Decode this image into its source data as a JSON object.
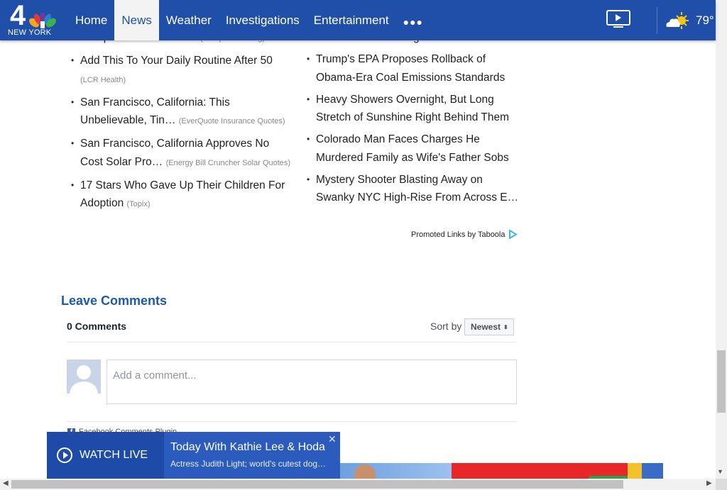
{
  "header": {
    "logo_number": "4",
    "logo_city": "NEW YORK",
    "nav": [
      "Home",
      "News",
      "Weather",
      "Investigations",
      "Entertainment"
    ],
    "active_nav": "News",
    "more_icon": "ellipsis-icon",
    "video_icon": "tv-play-icon",
    "weather_icon": "partly-cloudy-icon",
    "temperature": "79°"
  },
  "links_left": [
    {
      "title": "Companies in California",
      "source": "(Comparisons.org)"
    },
    {
      "title": "Add This To Your Daily Routine After 50",
      "source": "(LCR Health)"
    },
    {
      "title": "San Francisco, California: This Unbelievable, Tin…",
      "source": "(EverQuote Insurance Quotes)"
    },
    {
      "title": "San Francisco, California Approves No Cost Solar Pro…",
      "source": "(Energy Bill Cruncher Solar Quotes)"
    },
    {
      "title": "17 Stars Who Gave Up Their Children For Adoption",
      "source": "(Topix)"
    }
  ],
  "links_right": [
    {
      "title": "Months After Leaving Home"
    },
    {
      "title": "Trump's EPA Proposes Rollback of Obama-Era Coal Emissions Standards"
    },
    {
      "title": "Heavy Showers Overnight, But Long Stretch of Sunshine Right Behind Them"
    },
    {
      "title": "Colorado Man Faces Charges He Murdered Family as Wife's Father Sobs"
    },
    {
      "title": "Mystery Shooter Blasting Away on Swanky NYC High-Rise From Across E…"
    }
  ],
  "promo_text": "Promoted Links by Taboola",
  "comments": {
    "heading": "Leave Comments",
    "count_label": "0 Comments",
    "sort_label": "Sort by",
    "sort_value": "Newest",
    "placeholder": "Add a comment...",
    "plugin_label": "Facebook Comments Plugin"
  },
  "watch_live": {
    "label": "WATCH LIVE",
    "show_title": "Today With Kathie Lee & Hoda",
    "show_subtitle": "Actress Judith Light; world's cutest dog…",
    "close": "✕"
  },
  "colors": {
    "header_bg": "#1f4fa8",
    "accent_blue": "#1f5aa5",
    "watch_bg": "#2b5bbd"
  }
}
